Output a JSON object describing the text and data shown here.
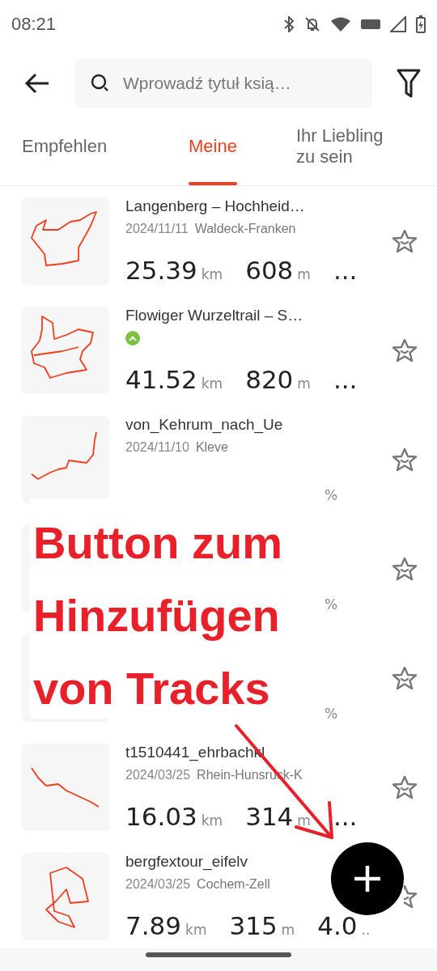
{
  "status_bar": {
    "time": "08:21"
  },
  "search": {
    "placeholder": "Wprowadź tytuł ksią…"
  },
  "tabs": [
    {
      "label": "Empfehlen",
      "selected": false
    },
    {
      "label": "Meine",
      "selected": true
    },
    {
      "label": "Ihr Liebling zu sein",
      "selected": false
    }
  ],
  "tracks": [
    {
      "kind": "dated",
      "title": "Langenberg – Hochheid…",
      "date": "2024/11/11",
      "region": "Waldeck-Franken",
      "stats": [
        {
          "value": "25.39",
          "unit": "km"
        },
        {
          "value": "608",
          "unit": "m"
        },
        {
          "value": "..."
        }
      ],
      "favorite": false
    },
    {
      "kind": "badge",
      "title": "Flowiger Wurzeltrail – S…",
      "stats": [
        {
          "value": "41.52",
          "unit": "km"
        },
        {
          "value": "820",
          "unit": "m"
        },
        {
          "value": "..."
        }
      ],
      "favorite": false
    },
    {
      "kind": "dated",
      "title": "von_Kehrum_nach_Ue",
      "date": "2024/11/10",
      "region": "Kleve",
      "stats": [
        {
          "unit": "%"
        }
      ],
      "favorite": false
    },
    {
      "kind": "covered",
      "stats": [
        {
          "unit": "%"
        }
      ],
      "favorite": false
    },
    {
      "kind": "covered",
      "stats": [
        {
          "unit": "%"
        }
      ],
      "favorite": false
    },
    {
      "kind": "dated",
      "title": "t1510441_ehrbachkl",
      "date": "2024/03/25",
      "region": "Rhein-Hunsruck-K",
      "stats": [
        {
          "value": "16.03",
          "unit": "km"
        },
        {
          "value": "314",
          "unit": "m"
        },
        {
          "value": "..."
        }
      ],
      "favorite": false
    },
    {
      "kind": "dated",
      "title": "bergfextour_eifelv",
      "date": "2024/03/25",
      "region": "Cochem-Zell",
      "stats": [
        {
          "value": "7.89",
          "unit": "km"
        },
        {
          "value": "315",
          "unit": "m"
        },
        {
          "value": "4.0",
          "unit": ".."
        }
      ],
      "favorite": false
    }
  ],
  "annotation": {
    "text": "Button zum Hinzufügen von Tracks"
  }
}
